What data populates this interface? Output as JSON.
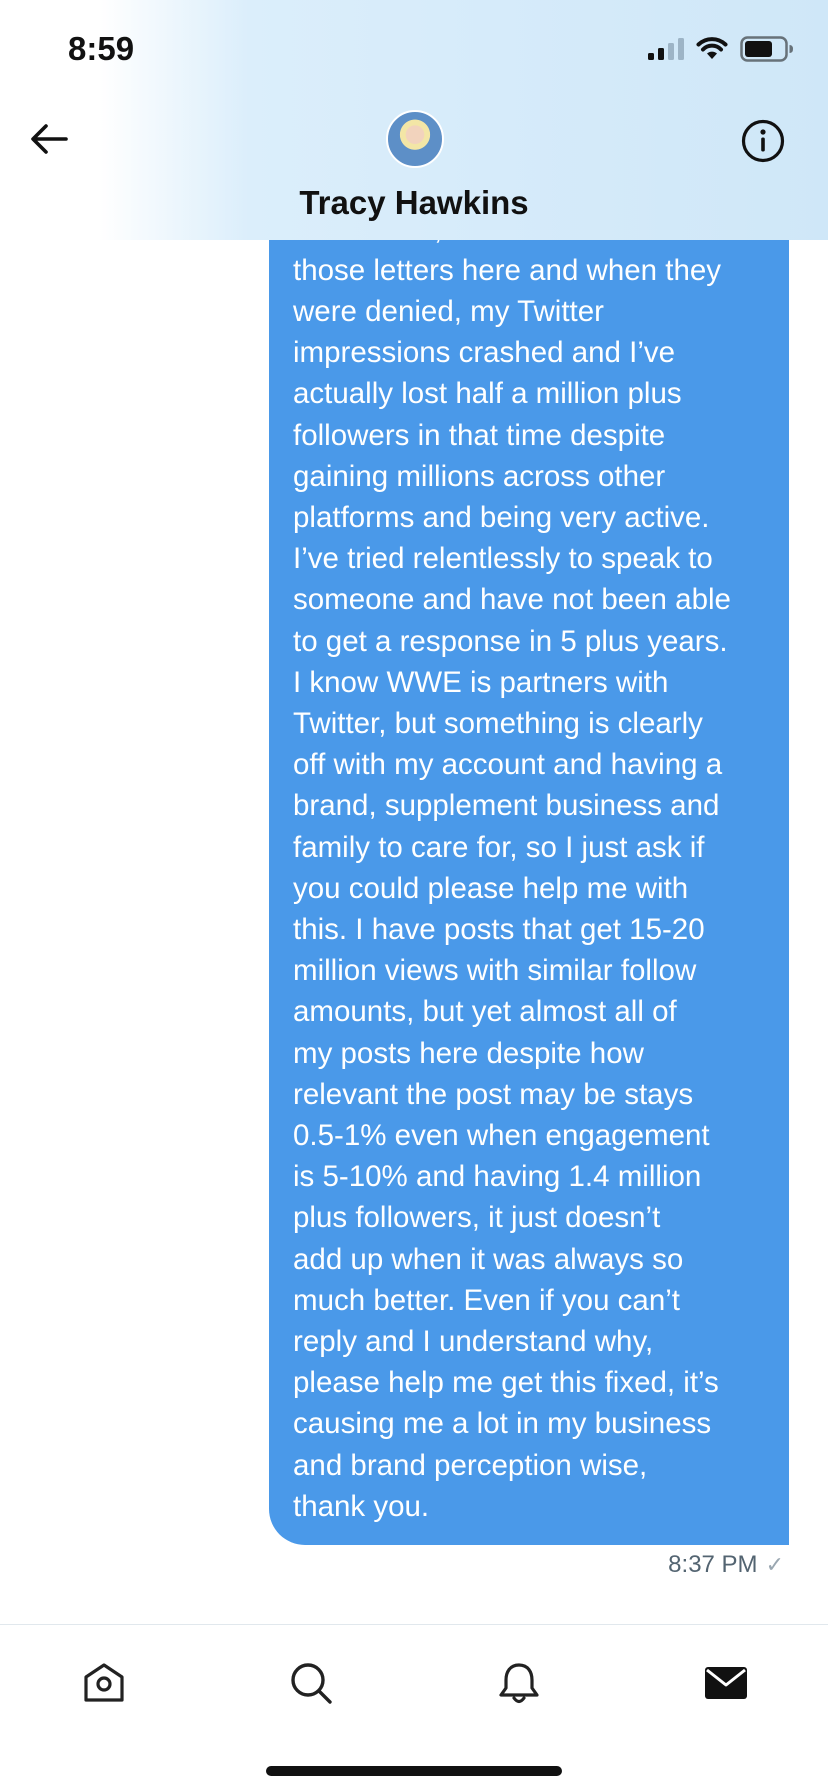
{
  "status_bar": {
    "time": "8:59"
  },
  "header": {
    "contact_name": "Tracy Hawkins"
  },
  "message": {
    "text": "walked out, which I will attach\nthose letters here and when they\nwere denied, my Twitter\nimpressions crashed and I’ve\nactually lost half a million plus\nfollowers in that time despite\ngaining millions across other\nplatforms and being very active.\nI’ve tried relentlessly to speak to\nsomeone and have not been able\nto get a response in 5 plus years.\nI know WWE is partners with\nTwitter, but something is clearly\noff with my account and having a\nbrand, supplement business and\nfamily to care for, so I just ask if\nyou could please help me with\nthis. I have posts that get 15-20\nmillion views with similar follow\namounts, but yet almost all of\nmy posts here despite how\nrelevant the post may be stays\n0.5-1% even when engagement\nis 5-10% and having 1.4 million\nplus followers, it just doesn’t\nadd up when it was always so\nmuch better. Even if you can’t\nreply and I understand why,\nplease help me get this fixed, it’s\ncausing me a lot in my business\nand brand perception wise,\nthank you.",
    "timestamp": "8:37 PM",
    "status_mark": "✓",
    "bubble_color": "#4a99e9"
  },
  "icons": {
    "back": "arrow-left-icon",
    "info": "info-icon",
    "signal": "cellular-signal-icon",
    "wifi": "wifi-icon",
    "battery": "battery-icon"
  },
  "tab_bar": {
    "tabs": [
      {
        "name": "home",
        "icon": "home-icon",
        "active": false
      },
      {
        "name": "search",
        "icon": "search-icon",
        "active": false
      },
      {
        "name": "notifications",
        "icon": "bell-icon",
        "active": false
      },
      {
        "name": "messages",
        "icon": "envelope-icon",
        "active": true
      }
    ]
  }
}
